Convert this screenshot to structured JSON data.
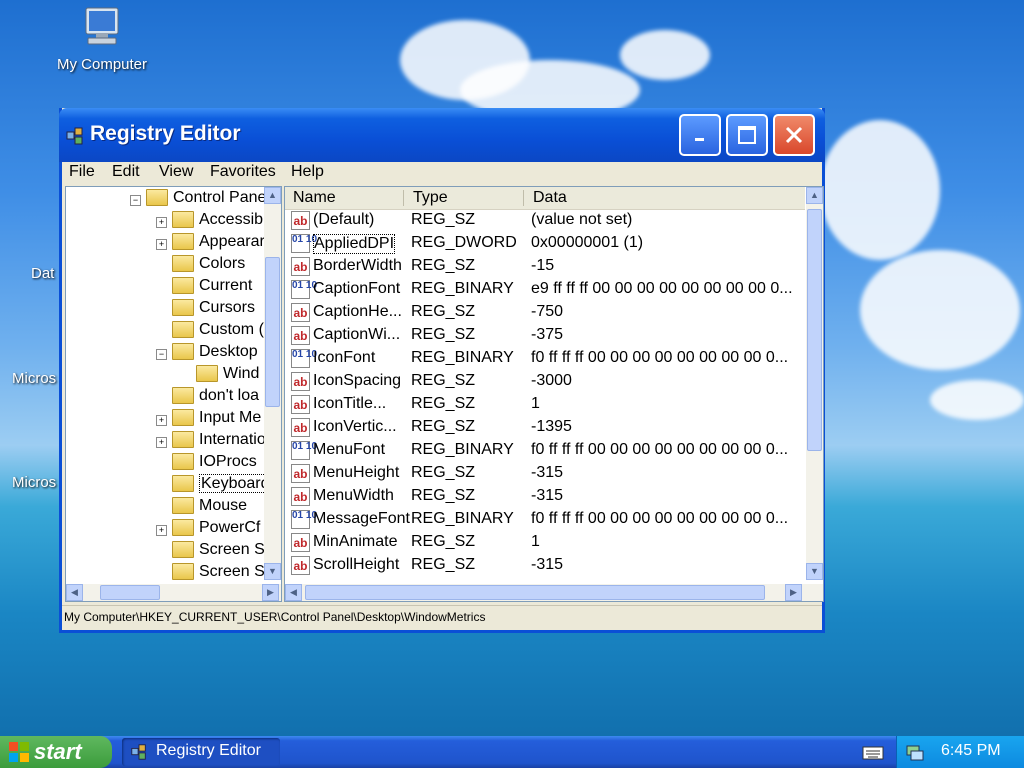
{
  "desktop": {
    "icons": [
      {
        "label": "My Computer",
        "icon": "my-computer-icon"
      }
    ],
    "partial_labels": [
      "Dat",
      "Micros",
      "Micros"
    ]
  },
  "window": {
    "title": "Registry Editor",
    "controls": {
      "minimize": "minimize-icon",
      "maximize": "maximize-icon",
      "close": "close-icon"
    },
    "menu": [
      "File",
      "Edit",
      "View",
      "Favorites",
      "Help"
    ],
    "tree": [
      {
        "label": "Control Panel",
        "expanded": true
      },
      {
        "label": "Accessibility",
        "expandable": true
      },
      {
        "label": "Appearance",
        "expandable": true
      },
      {
        "label": "Colors"
      },
      {
        "label": "Current"
      },
      {
        "label": "Cursors"
      },
      {
        "label": "Custom Colors"
      },
      {
        "label": "Desktop",
        "expanded": true
      },
      {
        "label": "WindowMetrics",
        "selected_folder": true
      },
      {
        "label": "don't load"
      },
      {
        "label": "Input Method",
        "expandable": true
      },
      {
        "label": "International",
        "expandable": true
      },
      {
        "label": "IOProcs"
      },
      {
        "label": "Keyboard",
        "focused": true
      },
      {
        "label": "Mouse"
      },
      {
        "label": "PowerCfg",
        "expandable": true
      },
      {
        "label": "Screen Saver"
      },
      {
        "label": "Screen Saver"
      }
    ],
    "tree_display": [
      "Control Pane",
      "Accessib",
      "Appearar",
      "Colors",
      "Current",
      "Cursors",
      "Custom (",
      "Desktop",
      "Wind",
      "don't loa",
      "Input Me",
      "Internatio",
      "IOProcs",
      "Keyboard",
      "Mouse",
      "PowerCf",
      "Screen S",
      "Screen S"
    ],
    "columns": {
      "name": "Name",
      "type": "Type",
      "data": "Data"
    },
    "values": [
      {
        "name": "(Default)",
        "type": "REG_SZ",
        "data": "(value not set)",
        "kind": "sz"
      },
      {
        "name": "AppliedDPI",
        "type": "REG_DWORD",
        "data": "0x00000001 (1)",
        "kind": "bin"
      },
      {
        "name": "BorderWidth",
        "type": "REG_SZ",
        "data": "-15",
        "kind": "sz"
      },
      {
        "name": "CaptionFont",
        "type": "REG_BINARY",
        "data": "e9 ff ff ff 00 00 00 00 00 00 00 00 0...",
        "kind": "bin"
      },
      {
        "name": "CaptionHe...",
        "type": "REG_SZ",
        "data": "-750",
        "kind": "sz"
      },
      {
        "name": "CaptionWi...",
        "type": "REG_SZ",
        "data": "-375",
        "kind": "sz"
      },
      {
        "name": "IconFont",
        "type": "REG_BINARY",
        "data": "f0 ff ff ff 00 00 00 00 00 00 00 00 0...",
        "kind": "bin"
      },
      {
        "name": "IconSpacing",
        "type": "REG_SZ",
        "data": "-3000",
        "kind": "sz"
      },
      {
        "name": "IconTitle...",
        "type": "REG_SZ",
        "data": "1",
        "kind": "sz"
      },
      {
        "name": "IconVertic...",
        "type": "REG_SZ",
        "data": "-1395",
        "kind": "sz"
      },
      {
        "name": "MenuFont",
        "type": "REG_BINARY",
        "data": "f0 ff ff ff 00 00 00 00 00 00 00 00 0...",
        "kind": "bin"
      },
      {
        "name": "MenuHeight",
        "type": "REG_SZ",
        "data": "-315",
        "kind": "sz"
      },
      {
        "name": "MenuWidth",
        "type": "REG_SZ",
        "data": "-315",
        "kind": "sz"
      },
      {
        "name": "MessageFont",
        "type": "REG_BINARY",
        "data": "f0 ff ff ff 00 00 00 00 00 00 00 00 0...",
        "kind": "bin"
      },
      {
        "name": "MinAnimate",
        "type": "REG_SZ",
        "data": "1",
        "kind": "sz"
      },
      {
        "name": "ScrollHeight",
        "type": "REG_SZ",
        "data": "-315",
        "kind": "sz"
      }
    ],
    "status": "My Computer\\HKEY_CURRENT_USER\\Control Panel\\Desktop\\WindowMetrics"
  },
  "taskbar": {
    "start_label": "start",
    "tasks": [
      {
        "label": "Registry Editor",
        "icon": "registry-icon"
      }
    ],
    "clock": "6:45 PM"
  },
  "colors": {
    "titlebar": "#0a4fd6",
    "taskbar": "#245edb",
    "start": "#3c9c3c",
    "close": "#d9472b"
  }
}
